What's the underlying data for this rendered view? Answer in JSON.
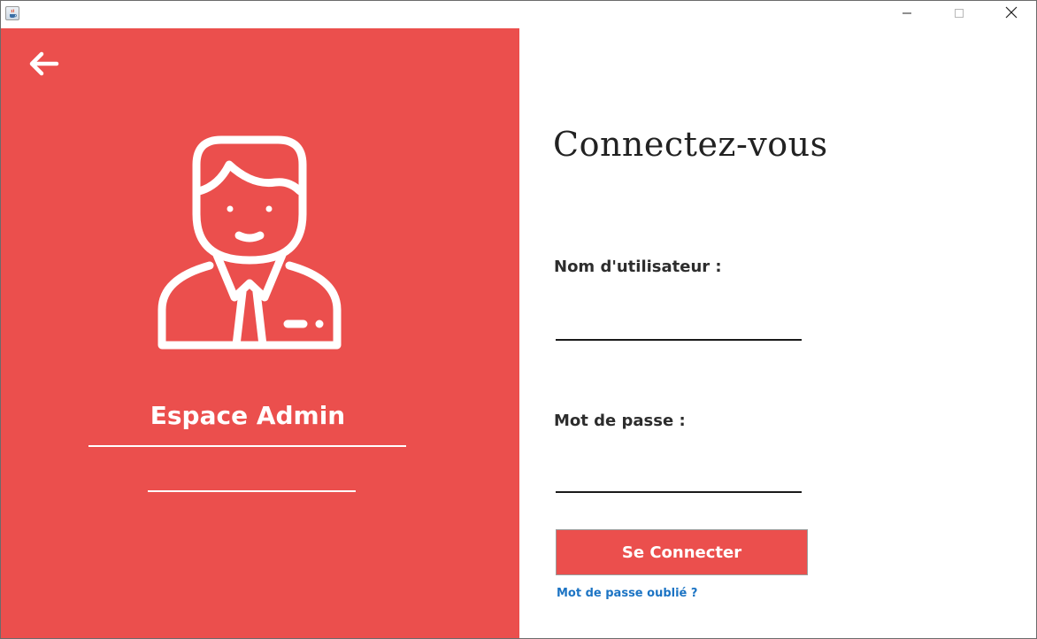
{
  "window": {
    "icon": "java-app-icon",
    "controls": [
      "minimize-icon",
      "maximize-icon",
      "close-icon"
    ]
  },
  "left_panel": {
    "background": "#eb4f4d",
    "back_icon": "arrow-left-icon",
    "avatar_icon": "admin-user-icon",
    "role_title": "Espace Admin"
  },
  "form": {
    "heading": "Connectez-vous",
    "username_label": "Nom d'utilisateur :",
    "username_value": "",
    "password_label": "Mot de passe :",
    "password_value": "",
    "submit_label": "Se Connecter",
    "forgot_label": "Mot de passe oublié ?"
  },
  "colors": {
    "accent": "#eb4f4d",
    "link": "#1c74c4",
    "text": "#2d2d2d"
  }
}
